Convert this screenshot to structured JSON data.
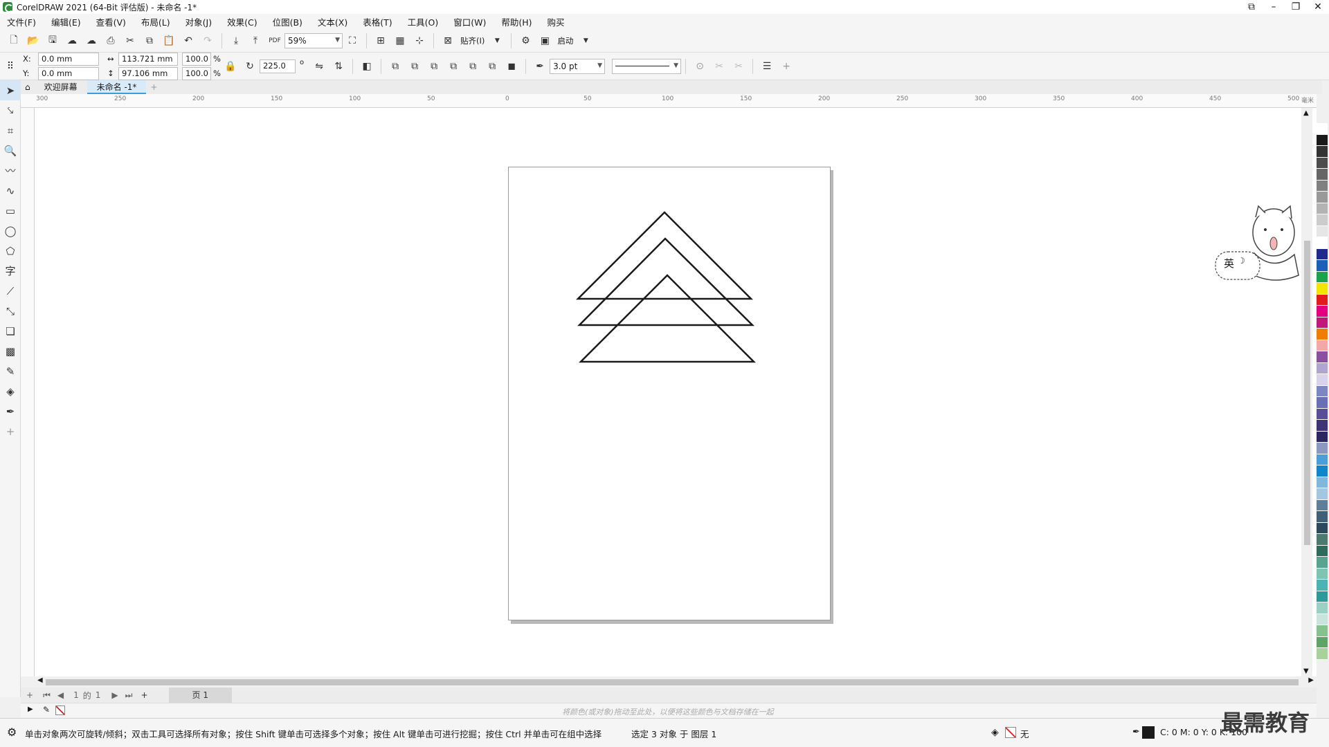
{
  "window": {
    "title": "CorelDRAW 2021 (64-Bit 评估版) - 未命名 -1*",
    "controls": [
      "⧉",
      "–",
      "❐",
      "✕"
    ]
  },
  "menu": [
    "文件(F)",
    "编辑(E)",
    "查看(V)",
    "布局(L)",
    "对象(J)",
    "效果(C)",
    "位图(B)",
    "文本(X)",
    "表格(T)",
    "工具(O)",
    "窗口(W)",
    "帮助(H)",
    "购买"
  ],
  "toolbar1": {
    "zoom": "59%",
    "snap_label": "贴齐(I)",
    "launch_label": "启动"
  },
  "toolbar2": {
    "x_label": "X:",
    "y_label": "Y:",
    "x_value": "0.0 mm",
    "y_value": "0.0 mm",
    "width_value": "113.721 mm",
    "height_value": "97.106 mm",
    "scale_x": "100.0",
    "scale_y": "100.0",
    "percent": "%",
    "rotation": "225.0",
    "degree": "o",
    "outline_width": "3.0 pt"
  },
  "tabs": {
    "welcome": "欢迎屏幕",
    "document": "未命名 -1*",
    "add": "+"
  },
  "ruler": {
    "h_ticks": [
      "300",
      "250",
      "200",
      "150",
      "100",
      "50",
      "0",
      "50",
      "100",
      "150",
      "200",
      "250",
      "300",
      "350",
      "400",
      "450",
      "500"
    ],
    "unit": "毫米"
  },
  "pagenav": {
    "current": "1",
    "of": "的",
    "total": "1",
    "page_tab": "页 1"
  },
  "color_docker_hint": "将颜色(或对象)拖动至此处，以便将这些颜色与文档存储在一起",
  "status": {
    "hint": "单击对象两次可旋转/倾斜；双击工具可选择所有对象；按住 Shift 键单击可选择多个对象；按住 Alt 键单击可进行挖掘；按住 Ctrl 并单击可在组中选择",
    "selection": "选定 3 对象 于 图层 1",
    "fill_label": "无",
    "color_readout": "C: 0 M: 0 Y: 0 K: 100"
  },
  "mascot": {
    "ime_label": "英"
  },
  "watermark": "最需教育",
  "palette": [
    "#ffffff",
    "#1a1a1a",
    "#333333",
    "#4d4d4d",
    "#666666",
    "#808080",
    "#999999",
    "#b3b3b3",
    "#cccccc",
    "#e6e6e6",
    "#ffffff",
    "#1f2a8c",
    "#1c5fb8",
    "#1ba34a",
    "#f2e500",
    "#e21c1c",
    "#e4007f",
    "#c2187a",
    "#ef7d00",
    "#f4a7a7",
    "#8a4f9e",
    "#b0a5cf",
    "#d8d3ea",
    "#7c86c2",
    "#6a70b4",
    "#5a4f96",
    "#3f3576",
    "#2d2760",
    "#8c98bf",
    "#4a9fd8",
    "#0f86cc",
    "#7fb7dd",
    "#a4c6e0",
    "#5e7f99",
    "#3f6178",
    "#2d4a5c",
    "#4d7a6e",
    "#2f6b5c",
    "#5aa38f",
    "#7fc4b3",
    "#4bb3b3",
    "#2c9a9a",
    "#9bd0c5",
    "#c7e5dc",
    "#86c28c",
    "#5ea565",
    "#a7d39b"
  ]
}
